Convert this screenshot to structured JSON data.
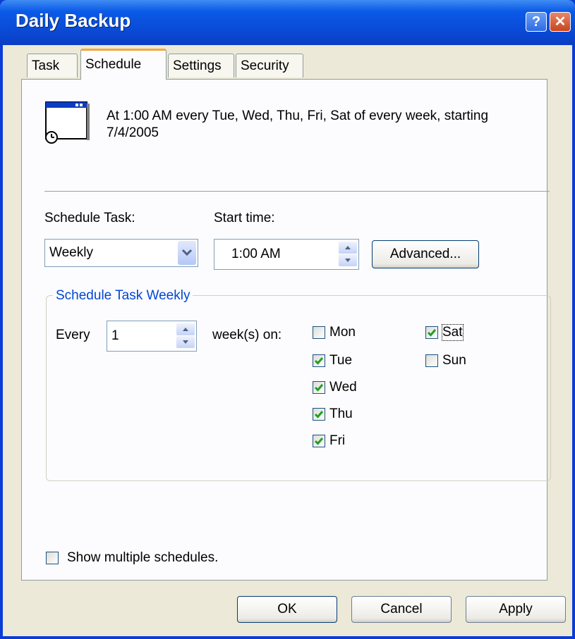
{
  "window": {
    "title": "Daily Backup",
    "help_glyph": "?",
    "close_glyph": "✕"
  },
  "tabs": [
    {
      "label": "Task"
    },
    {
      "label": "Schedule"
    },
    {
      "label": "Settings"
    },
    {
      "label": "Security"
    }
  ],
  "active_tab": "Schedule",
  "summary": {
    "text": "At 1:00 AM every Tue, Wed, Thu, Fri, Sat of every week, starting 7/4/2005",
    "icon": "scheduled-task-clock-icon"
  },
  "schedule_task": {
    "label": "Schedule Task:",
    "value": "Weekly"
  },
  "start_time": {
    "label": "Start time:",
    "value": "1:00 AM"
  },
  "advanced_button": "Advanced...",
  "weekly_group": {
    "title": "Schedule Task Weekly",
    "every_label": "Every",
    "every_value": "1",
    "weeks_on_label": "week(s) on:",
    "days": [
      {
        "label": "Mon",
        "checked": false
      },
      {
        "label": "Tue",
        "checked": true
      },
      {
        "label": "Wed",
        "checked": true
      },
      {
        "label": "Thu",
        "checked": true
      },
      {
        "label": "Fri",
        "checked": true
      },
      {
        "label": "Sat",
        "checked": true
      },
      {
        "label": "Sun",
        "checked": false
      }
    ]
  },
  "show_multiple": {
    "label": "Show multiple schedules.",
    "checked": false
  },
  "buttons": {
    "ok": "OK",
    "cancel": "Cancel",
    "apply": "Apply"
  },
  "colors": {
    "titlebar": "#0a49d4",
    "client": "#ece9d8",
    "group_title": "#0046d5",
    "active_tab_accent": "#f7a73b"
  }
}
